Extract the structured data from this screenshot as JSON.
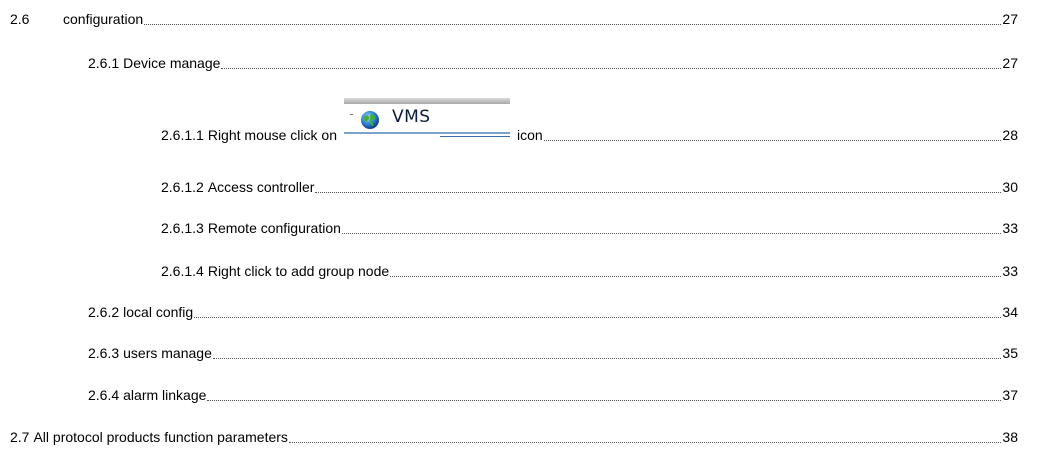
{
  "toc": {
    "entries": [
      {
        "number": "2.6",
        "title": "configuration",
        "page": "27"
      },
      {
        "number": "2.6.1",
        "title": "Device manage",
        "page": "27"
      },
      {
        "number": "2.6.1.1",
        "title_before": "Right mouse click on",
        "image_label": "VMS",
        "title_after": "icon",
        "page": "28"
      },
      {
        "number": "2.6.1.2",
        "title": "Access controller",
        "page": "30"
      },
      {
        "number": "2.6.1.3",
        "title": "Remote configuration",
        "page": "33"
      },
      {
        "number": "2.6.1.4",
        "title": "Right click to add group node",
        "page": "33"
      },
      {
        "number": "2.6.2",
        "title": "local config",
        "page": "34"
      },
      {
        "number": "2.6.3",
        "title": "users manage",
        "page": "35"
      },
      {
        "number": "2.6.4",
        "title": "alarm linkage",
        "page": "37"
      },
      {
        "number": "2.7",
        "title": "All protocol products function parameters",
        "page": "38"
      }
    ]
  }
}
